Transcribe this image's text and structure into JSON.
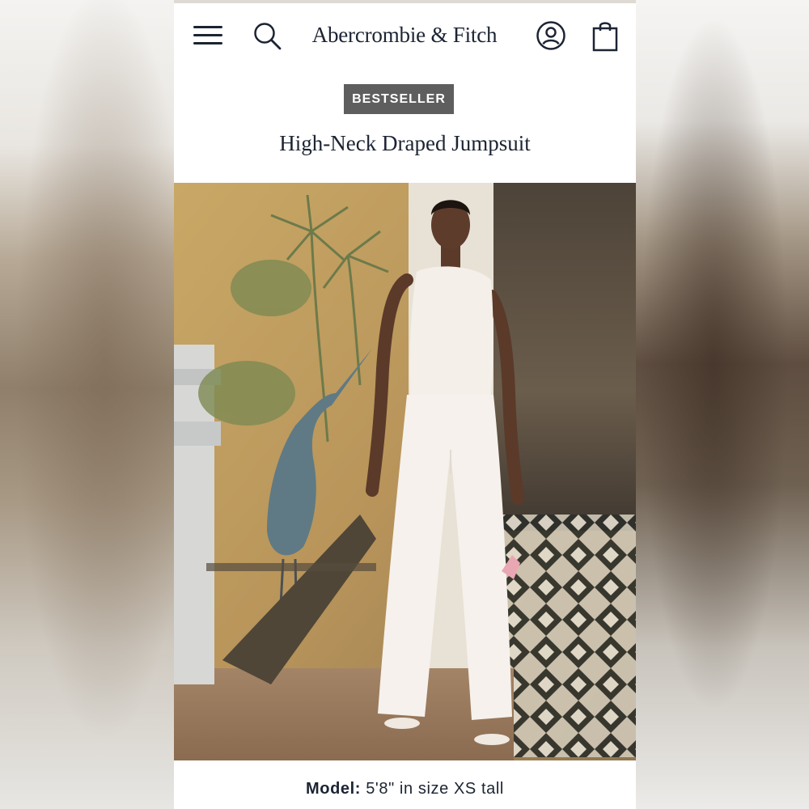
{
  "header": {
    "brand": "Abercrombie & Fitch",
    "icons": [
      "hamburger-menu-icon",
      "search-icon",
      "account-icon",
      "shopping-bag-icon"
    ]
  },
  "product": {
    "badge": "BESTSELLER",
    "title": "High-Neck Draped Jumpsuit"
  },
  "model_info": {
    "label": "Model:",
    "text": " 5'8\" in size XS tall"
  },
  "colors": {
    "text_dark": "#1c2433",
    "badge_bg": "#5e5e5e",
    "page_bg": "#ffffff"
  }
}
